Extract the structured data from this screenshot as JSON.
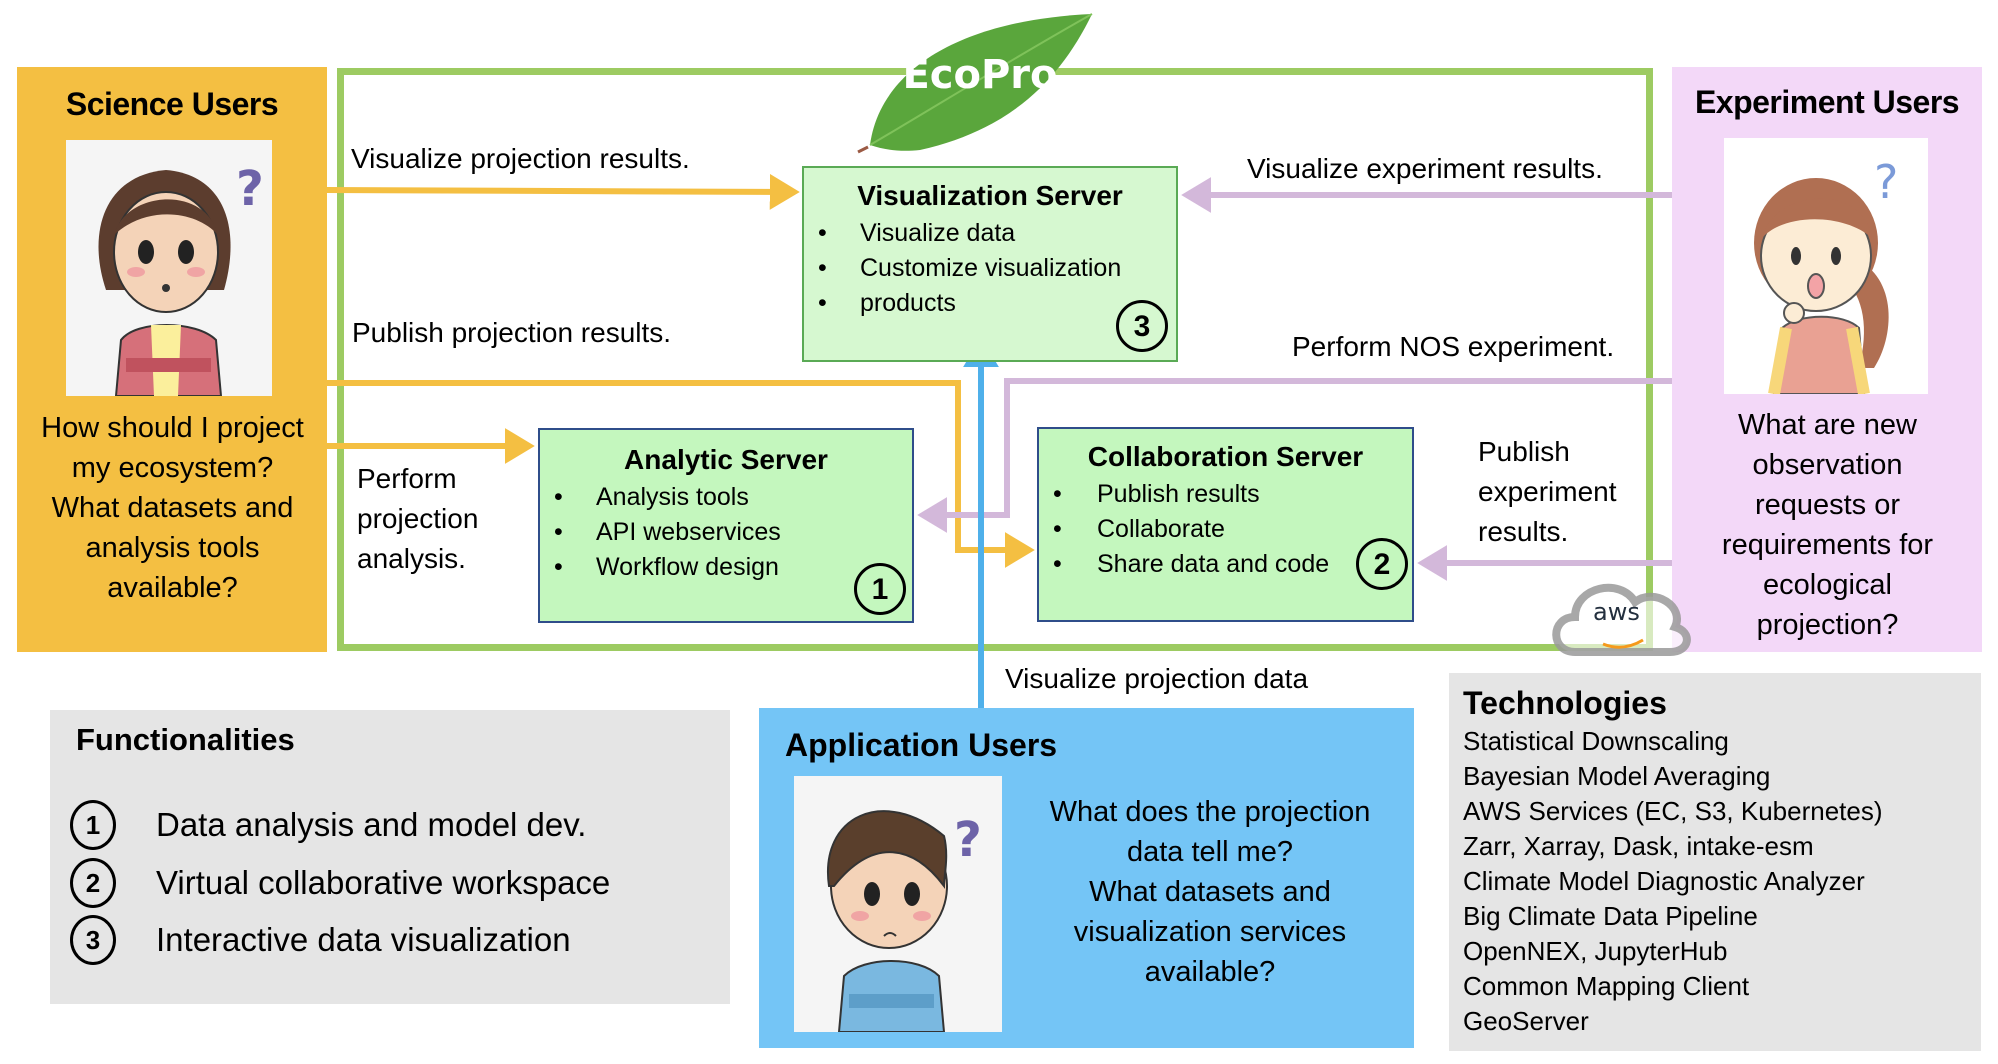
{
  "brand": {
    "name": "EcoPro",
    "logo": "leaf-icon"
  },
  "science_users": {
    "title": "Science Users",
    "avatar": "woman-thinking-avatar",
    "question": "How should I project my ecosystem? What datasets and analysis tools available?"
  },
  "experiment_users": {
    "title": "Experiment Users",
    "avatar": "girl-wondering-avatar",
    "question": "What are new observation requests or requirements for ecological projection?"
  },
  "application_users": {
    "title": "Application Users",
    "avatar": "boy-thinking-avatar",
    "question_lines": [
      "What does the projection",
      "data tell me?",
      "What datasets and",
      "visualization services",
      "available?"
    ]
  },
  "servers": {
    "visualization": {
      "title": "Visualization Server",
      "items": [
        "Visualize data",
        "Customize visualization",
        "products"
      ],
      "number": "3"
    },
    "analytic": {
      "title": "Analytic Server",
      "items": [
        "Analysis tools",
        "API webservices",
        "Workflow design"
      ],
      "number": "1"
    },
    "collaboration": {
      "title": "Collaboration Server",
      "items": [
        "Publish results",
        "Collaborate",
        "Share data and code"
      ],
      "number": "2"
    }
  },
  "flows": {
    "visualize_projection_results": "Visualize projection results.",
    "publish_projection_results": "Publish projection results.",
    "perform_projection_analysis": [
      "Perform",
      "projection",
      "analysis."
    ],
    "visualize_experiment_results": "Visualize experiment results.",
    "perform_nos_experiment": "Perform NOS experiment.",
    "publish_experiment_results": [
      "Publish",
      "experiment",
      "results."
    ],
    "visualize_projection_data": "Visualize projection data"
  },
  "cloud": {
    "label": "aws",
    "icon": "aws-cloud-icon"
  },
  "functionalities": {
    "title": "Functionalities",
    "items": [
      {
        "number": "1",
        "label": "Data analysis and model dev."
      },
      {
        "number": "2",
        "label": "Virtual collaborative workspace"
      },
      {
        "number": "3",
        "label": "Interactive data visualization"
      }
    ]
  },
  "technologies": {
    "title": "Technologies",
    "items": [
      "Statistical Downscaling",
      "Bayesian Model Averaging",
      "AWS Services (EC, S3, Kubernetes)",
      "Zarr, Xarray, Dask, intake-esm",
      "Climate Model Diagnostic Analyzer",
      "Big Climate Data Pipeline",
      "OpenNEX, JupyterHub",
      "Common Mapping Client",
      "GeoServer"
    ]
  },
  "colors": {
    "science": "#f4bf42",
    "experiment": "#f3d8f8",
    "application": "#74c5f6",
    "frame": "#9dcb62",
    "science_flow": "#f4bf42",
    "experiment_flow": "#d3b8da",
    "application_flow": "#4fb0ea"
  }
}
